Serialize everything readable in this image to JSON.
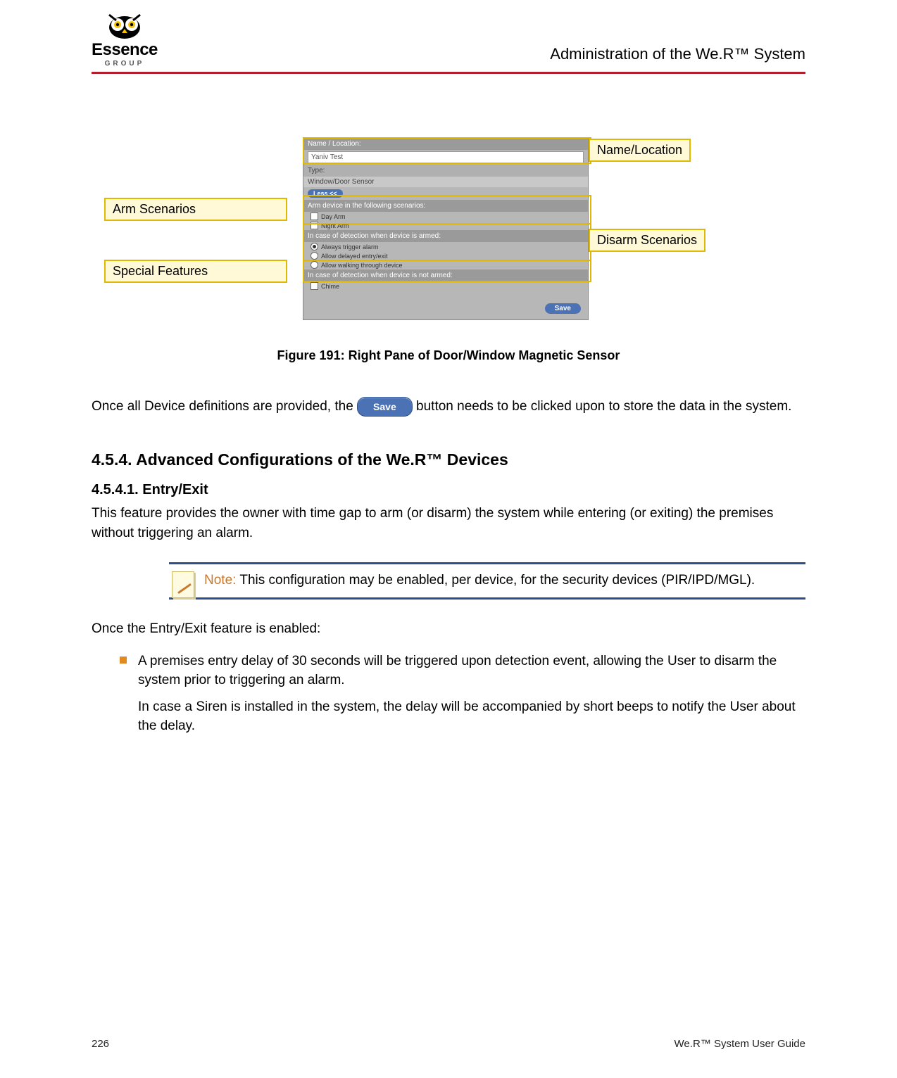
{
  "header": {
    "logo_text": "Essence",
    "logo_sub": "GROUP",
    "title": "Administration of the We.R™ System"
  },
  "callouts": {
    "name_location": "Name/Location",
    "arm_scenarios": "Arm Scenarios",
    "disarm_scenarios": "Disarm Scenarios",
    "special_features": "Special Features"
  },
  "panel": {
    "name_label": "Name / Location:",
    "name_value": "Yaniv Test",
    "type_label": "Type:",
    "type_value": "Window/Door Sensor",
    "less_label": "Less <<",
    "arm_header": "Arm device in the following scenarios:",
    "arm_options": [
      "Day Arm",
      "Night Arm"
    ],
    "armed_header": "In case of detection when device is armed:",
    "armed_options": [
      "Always trigger alarm",
      "Allow delayed entry/exit",
      "Allow walking through device"
    ],
    "not_armed_header": "In case of detection when device is not armed:",
    "not_armed_options": [
      "Chime"
    ],
    "save_label": "Save"
  },
  "figure_caption": "Figure 191: Right Pane of Door/Window Magnetic Sensor",
  "para1_a": "Once all Device definitions are provided, the ",
  "inline_save_label": "Save",
  "para1_b": " button needs to be clicked upon to store the data in the system.",
  "section_heading": "4.5.4.    Advanced Configurations of the We.R™ Devices",
  "subsection_heading": "4.5.4.1.       Entry/Exit",
  "para2": "This feature provides the owner with time gap to arm (or disarm) the system while entering (or exiting) the premises without triggering an alarm.",
  "note_label": "Note:",
  "note_text": " This configuration may be enabled, per device, for the security devices (PIR/IPD/MGL).",
  "para3": "Once the Entry/Exit feature is enabled:",
  "bullet1": "A premises entry delay of 30 seconds will be triggered upon detection event, allowing the User to disarm the system prior to triggering an alarm.",
  "bullet1b": "In case a Siren is installed in the system, the delay will be accompanied by short beeps to notify the User about the delay.",
  "footer": {
    "page": "226",
    "doc": "We.R™ System User Guide"
  }
}
